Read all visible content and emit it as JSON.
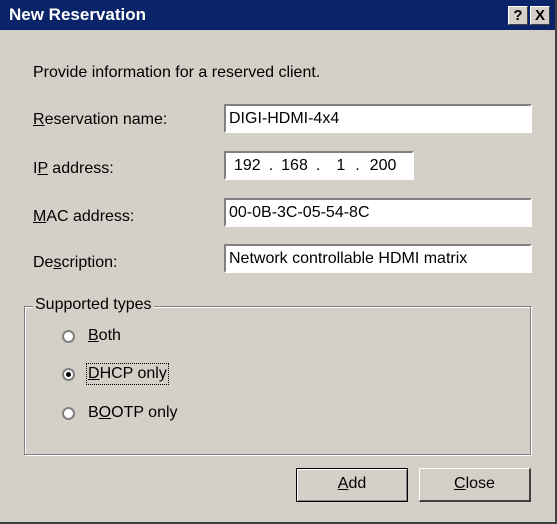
{
  "window": {
    "title": "New Reservation",
    "help_btn": "?",
    "close_btn": "X"
  },
  "intro": "Provide information for a reserved client.",
  "fields": {
    "reservation_name": {
      "label_key": "R",
      "label_rest": "eservation name:",
      "value": "DIGI-HDMI-4x4"
    },
    "ip_address": {
      "label_pre": "I",
      "label_key": "P",
      "label_rest": " address:",
      "octets": [
        "192",
        "168",
        "1",
        "200"
      ]
    },
    "mac_address": {
      "label_key": "M",
      "label_rest": "AC address:",
      "value": "00-0B-3C-05-54-8C"
    },
    "description": {
      "label_pre": "De",
      "label_key": "s",
      "label_rest": "cription:",
      "value": "Network controllable HDMI matrix"
    }
  },
  "supported_types": {
    "label": "Supported types",
    "options": [
      {
        "key": "B",
        "rest": "oth",
        "selected": false
      },
      {
        "key": "D",
        "rest": "HCP only",
        "selected": true
      },
      {
        "pre": "B",
        "key": "O",
        "rest": "OTP only",
        "selected": false
      }
    ]
  },
  "buttons": {
    "add_key": "A",
    "add_rest": "dd",
    "close_key": "C",
    "close_rest": "lose"
  }
}
